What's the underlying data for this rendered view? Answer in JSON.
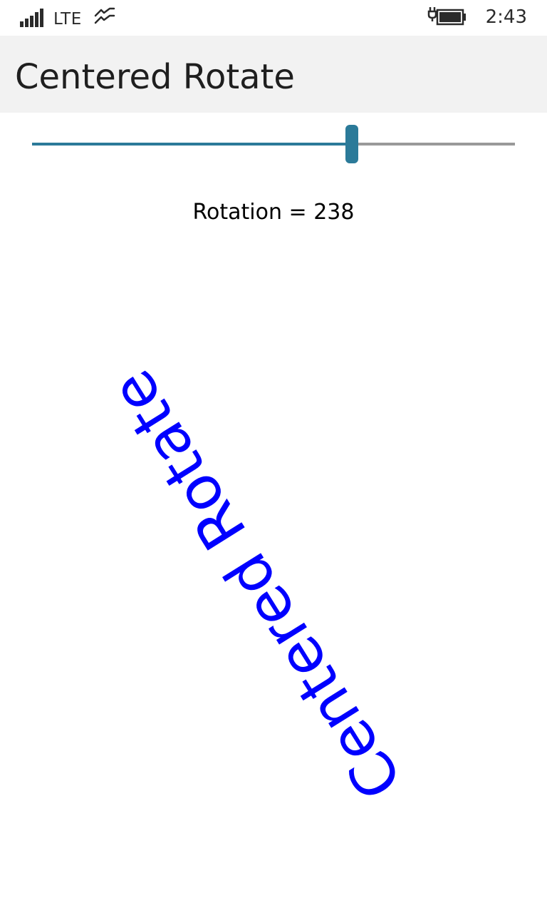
{
  "status_bar": {
    "signal_icon": "signal-bars-icon",
    "network": "LTE",
    "data_icon": "data-connection-icon",
    "battery_icon": "battery-charging-icon",
    "time": "2:43"
  },
  "header": {
    "title": "Centered Rotate"
  },
  "slider": {
    "min": 0,
    "max": 360,
    "value": 238
  },
  "readout": {
    "label": "Rotation = ",
    "value": "238"
  },
  "rotated_text": {
    "text": "Centered Rotate",
    "rotation_degrees": 238
  },
  "colors": {
    "accent": "#2b7a99",
    "track": "#999999",
    "rotated_text": "#0000ff",
    "header_bg": "#f2f2f2"
  }
}
